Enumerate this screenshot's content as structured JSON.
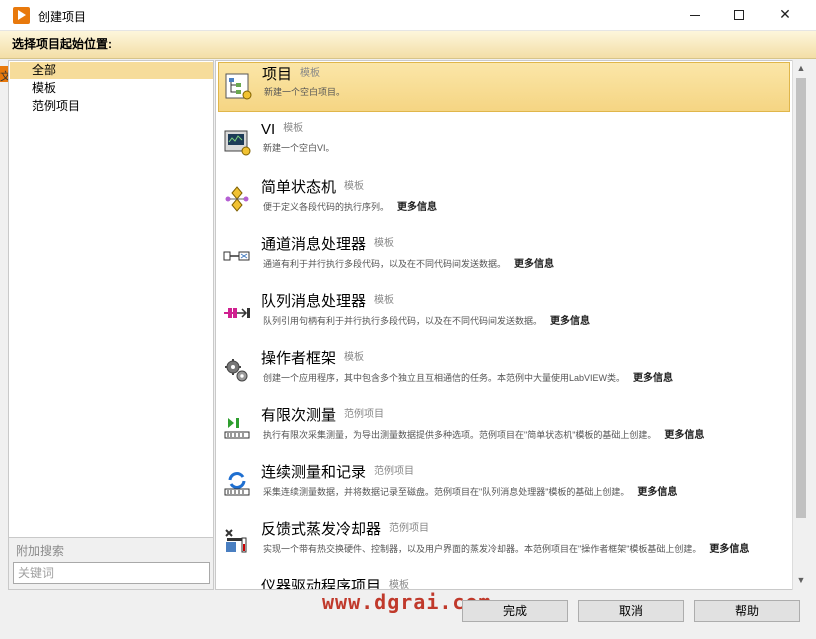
{
  "window": {
    "title": "创建项目",
    "minimize_glyph": "",
    "close_glyph": "✕"
  },
  "header": {
    "label": "选择项目起始位置:"
  },
  "categories": [
    {
      "label": "全部"
    },
    {
      "label": "模板"
    },
    {
      "label": "范例项目"
    }
  ],
  "search": {
    "label": "附加搜索",
    "placeholder": "关键词"
  },
  "templates": [
    {
      "name": "项目",
      "type": "模板",
      "desc": "新建一个空白项目。",
      "more": "",
      "icon": "project-icon"
    },
    {
      "name": "VI",
      "type": "模板",
      "desc": "新建一个空白VI。",
      "more": "",
      "icon": "vi-icon"
    },
    {
      "name": "简单状态机",
      "type": "模板",
      "desc": "便于定义各段代码的执行序列。",
      "more": "更多信息",
      "icon": "state-machine-icon"
    },
    {
      "name": "通道消息处理器",
      "type": "模板",
      "desc": "通道有利于并行执行多段代码，以及在不同代码间发送数据。",
      "more": "更多信息",
      "icon": "channel-handler-icon"
    },
    {
      "name": "队列消息处理器",
      "type": "模板",
      "desc": "队列引用句柄有利于并行执行多段代码，以及在不同代码间发送数据。",
      "more": "更多信息",
      "icon": "queue-handler-icon"
    },
    {
      "name": "操作者框架",
      "type": "模板",
      "desc": "创建一个应用程序，其中包含多个独立且互相通信的任务。本范例中大量使用LabVIEW类。",
      "more": "更多信息",
      "icon": "gears-icon"
    },
    {
      "name": "有限次测量",
      "type": "范例项目",
      "desc": "执行有限次采集测量，为导出测量数据提供多种选项。范例项目在\"简单状态机\"模板的基础上创建。",
      "more": "更多信息",
      "icon": "finite-measure-icon"
    },
    {
      "name": "连续测量和记录",
      "type": "范例项目",
      "desc": "采集连续测量数据，并将数据记录至磁盘。范例项目在\"队列消息处理器\"模板的基础上创建。",
      "more": "更多信息",
      "icon": "continuous-measure-icon"
    },
    {
      "name": "反馈式蒸发冷却器",
      "type": "范例项目",
      "desc": "实现一个带有热交换硬件、控制器，以及用户界面的蒸发冷却器。本范例项目在\"操作者框架\"模板基础上创建。",
      "more": "更多信息",
      "icon": "cooler-icon"
    },
    {
      "name": "仪器驱动程序项目",
      "type": "模板",
      "desc": "",
      "more": "",
      "icon": "instrument-driver-icon"
    }
  ],
  "scrollbar": {
    "up_glyph": "▲",
    "down_glyph": "▼"
  },
  "footer": {
    "watermark": "www.dgrai.com",
    "finish_label": "完成",
    "cancel_label": "取消",
    "help_label": "帮助"
  },
  "edge_fragment": "文",
  "colors": {
    "selection": "#f6dc9a",
    "header_bar": "#f3dea6",
    "brand": "#e8790c",
    "watermark": "#c0392b"
  }
}
